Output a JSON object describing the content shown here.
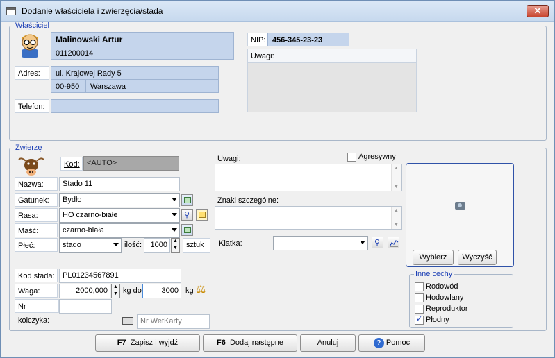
{
  "window": {
    "title": "Dodanie właściciela i zwierzęcia/stada"
  },
  "owner": {
    "legend": "Właściciel",
    "name": "Malinowski Artur",
    "id_number": "011200014",
    "nip_label": "NIP:",
    "nip": "456-345-23-23",
    "notes_label": "Uwagi:",
    "address_label": "Adres:",
    "street": "ul. Krajowej Rady 5",
    "postal_code": "00-950",
    "city": "Warszawa",
    "phone_label": "Telefon:",
    "phone": ""
  },
  "animals": {
    "legend": "Zwierzę",
    "kod_label": "Kod:",
    "kod": "<AUTO>",
    "nazwa_label": "Nazwa:",
    "nazwa": "Stado 11",
    "gatunek_label": "Gatunek:",
    "gatunek": "Bydło",
    "rasa_label": "Rasa:",
    "rasa": "HO czarno-białe",
    "masc_label": "Maść:",
    "masc": "czarno-biała",
    "plec_label": "Płeć:",
    "plec": "stado",
    "ilosc_label": "ilość:",
    "ilosc": "1000",
    "sztuk_label": "sztuk",
    "kod_stada_label": "Kod stada:",
    "kod_stada": "PL01234567891",
    "waga_label": "Waga:",
    "waga_od": "2000,000",
    "kg_do_label": "kg do",
    "waga_do": "3000",
    "kg_label": "kg",
    "kolczyk_label": "Nr kolczyka:",
    "kolczyk": "",
    "wetkarta_placeholder": "Nr WetKarty",
    "uwagi_label": "Uwagi:",
    "agresywny_label": "Agresywny",
    "znaki_label": "Znaki szczególne:",
    "klatka_label": "Klatka:",
    "klatka": ""
  },
  "photo": {
    "choose": "Wybierz",
    "clear": "Wyczyść"
  },
  "features": {
    "legend": "Inne cechy",
    "items": [
      {
        "label": "Rodowód",
        "checked": false
      },
      {
        "label": "Hodowlany",
        "checked": false
      },
      {
        "label": "Reproduktor",
        "checked": false
      },
      {
        "label": "Płodny",
        "checked": true
      }
    ]
  },
  "footer": {
    "save_key": "F7",
    "save_label": "Zapisz i wyjdź",
    "add_key": "F6",
    "add_label": "Dodaj następne",
    "cancel_label": "Anuluj",
    "help_label": "Pomoc"
  }
}
